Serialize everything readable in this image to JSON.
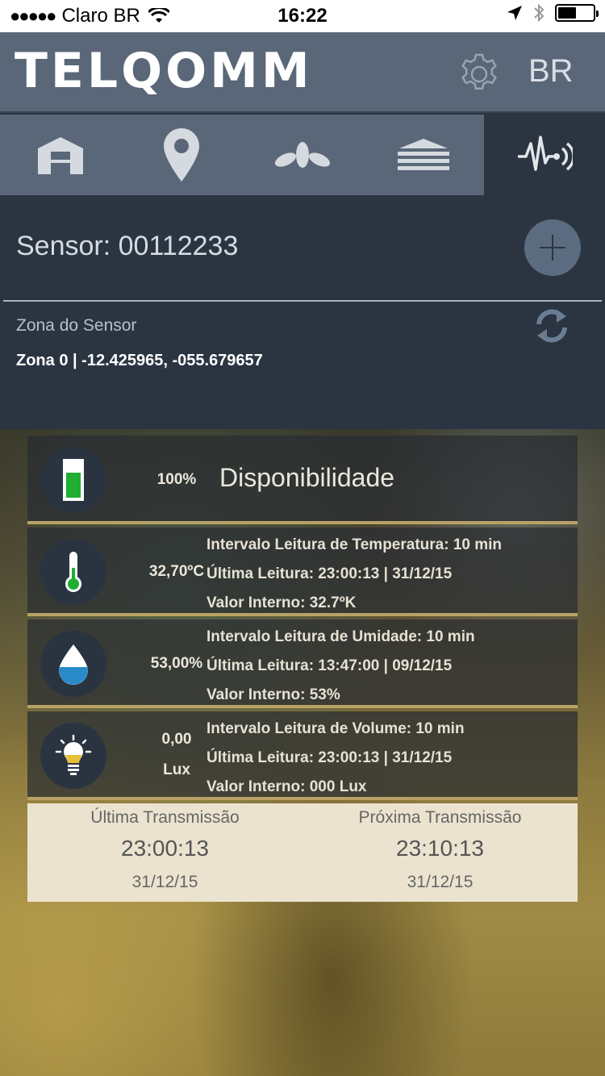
{
  "status_bar": {
    "carrier": "Claro BR",
    "time": "16:22"
  },
  "header": {
    "logo": "TELQOMM",
    "language": "BR"
  },
  "tabs": [
    {
      "name": "farm",
      "icon": "barn-icon",
      "active": false
    },
    {
      "name": "location",
      "icon": "map-pin-icon",
      "active": false
    },
    {
      "name": "crops",
      "icon": "leaves-icon",
      "active": false
    },
    {
      "name": "silo",
      "icon": "layers-icon",
      "active": false
    },
    {
      "name": "sensor",
      "icon": "sensor-signal-icon",
      "active": true
    }
  ],
  "sensor": {
    "title": "Sensor: 00112233",
    "add_label": "+",
    "zone_label": "Zona do Sensor",
    "zone_value": "Zona 0 | -12.425965, -055.679657"
  },
  "availability": {
    "value": "100%",
    "title": "Disponibilidade",
    "battery_level": 0.7
  },
  "temperature": {
    "value": "32,70ºC",
    "interval": "Intervalo Leitura de Temperatura: 10 min",
    "last_reading": "Última Leitura: 23:00:13 | 31/12/15",
    "internal": "Valor Interno: 32.7ºK"
  },
  "humidity": {
    "value": "53,00%",
    "interval": "Intervalo Leitura de Umidade: 10 min",
    "last_reading": "Última Leitura: 13:47:00 | 09/12/15",
    "internal": "Valor Interno: 53%"
  },
  "light": {
    "value_line1": "0,00",
    "value_line2": "Lux",
    "interval": "Intervalo Leitura de Volume: 10 min",
    "last_reading": "Última Leitura: 23:00:13 | 31/12/15",
    "internal": "Valor Interno: 000 Lux"
  },
  "transmission": {
    "last_label": "Última Transmissão",
    "last_time": "23:00:13",
    "last_date": "31/12/15",
    "next_label": "Próxima Transmissão",
    "next_time": "23:10:13",
    "next_date": "31/12/15"
  },
  "colors": {
    "header": "#5a6778",
    "panel": "#2b3542",
    "accent_green": "#1fae32",
    "water_blue": "#2a8bc9",
    "bulb_yellow": "#e8c035"
  }
}
